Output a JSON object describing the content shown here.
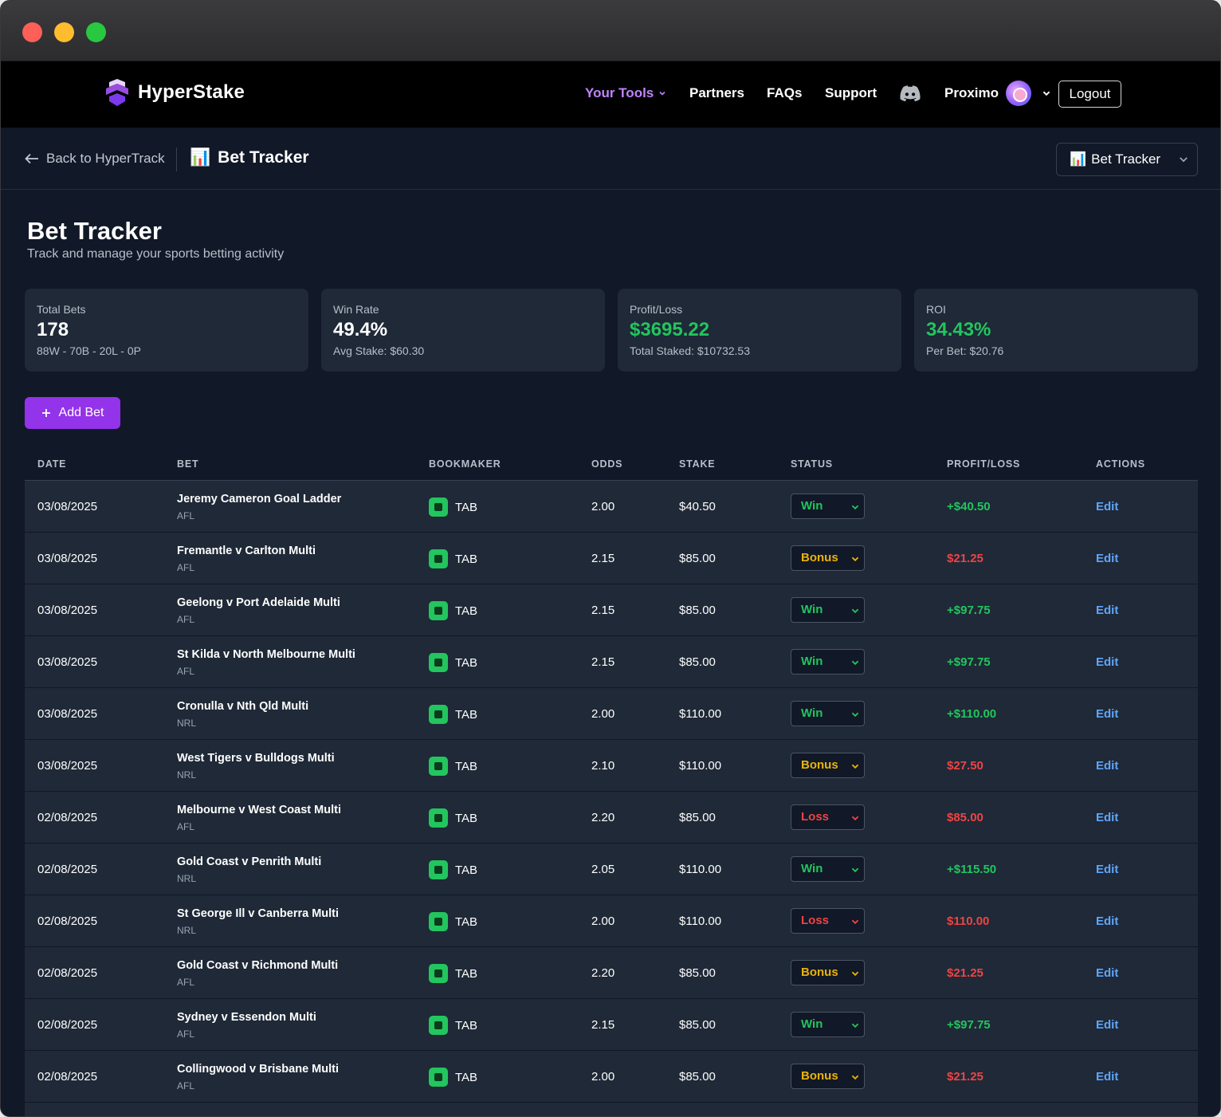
{
  "brand": {
    "name": "HyperStake"
  },
  "nav": {
    "tools": "Your Tools",
    "partners": "Partners",
    "faqs": "FAQs",
    "support": "Support",
    "user": "Proximo",
    "logout": "Logout"
  },
  "subbar": {
    "back": "Back to HyperTrack",
    "title": "Bet Tracker",
    "title_emoji": "📊",
    "tool_select": "Bet Tracker"
  },
  "page": {
    "title": "Bet Tracker",
    "subtitle": "Track and manage your sports betting activity"
  },
  "stats": [
    {
      "label": "Total Bets",
      "value": "178",
      "sub": "88W - 70B - 20L - 0P",
      "green": false
    },
    {
      "label": "Win Rate",
      "value": "49.4%",
      "sub": "Avg Stake: $60.30",
      "green": false
    },
    {
      "label": "Profit/Loss",
      "value": "$3695.22",
      "sub": "Total Staked: $10732.53",
      "green": true
    },
    {
      "label": "ROI",
      "value": "34.43%",
      "sub": "Per Bet: $20.76",
      "green": true
    }
  ],
  "add_bet": "Add Bet",
  "columns": [
    "DATE",
    "BET",
    "BOOKMAKER",
    "ODDS",
    "STAKE",
    "STATUS",
    "PROFIT/LOSS",
    "ACTIONS"
  ],
  "status_colors": {
    "Win": "#22c55e",
    "Bonus": "#eab308",
    "Loss": "#ef4444"
  },
  "pl_colors": {
    "positive": "#22c55e",
    "negative": "#ef4444"
  },
  "edit_label": "Edit",
  "rows": [
    {
      "date": "03/08/2025",
      "bet": "Jeremy Cameron Goal Ladder",
      "sport": "AFL",
      "book": "TAB",
      "odds": "2.00",
      "stake": "$40.50",
      "status": "Win",
      "pl": "+$40.50"
    },
    {
      "date": "03/08/2025",
      "bet": "Fremantle v Carlton Multi",
      "sport": "AFL",
      "book": "TAB",
      "odds": "2.15",
      "stake": "$85.00",
      "status": "Bonus",
      "pl": "$21.25"
    },
    {
      "date": "03/08/2025",
      "bet": "Geelong v Port Adelaide Multi",
      "sport": "AFL",
      "book": "TAB",
      "odds": "2.15",
      "stake": "$85.00",
      "status": "Win",
      "pl": "+$97.75"
    },
    {
      "date": "03/08/2025",
      "bet": "St Kilda v North Melbourne Multi",
      "sport": "AFL",
      "book": "TAB",
      "odds": "2.15",
      "stake": "$85.00",
      "status": "Win",
      "pl": "+$97.75"
    },
    {
      "date": "03/08/2025",
      "bet": "Cronulla v Nth Qld Multi",
      "sport": "NRL",
      "book": "TAB",
      "odds": "2.00",
      "stake": "$110.00",
      "status": "Win",
      "pl": "+$110.00"
    },
    {
      "date": "03/08/2025",
      "bet": "West Tigers v Bulldogs Multi",
      "sport": "NRL",
      "book": "TAB",
      "odds": "2.10",
      "stake": "$110.00",
      "status": "Bonus",
      "pl": "$27.50"
    },
    {
      "date": "02/08/2025",
      "bet": "Melbourne v West Coast Multi",
      "sport": "AFL",
      "book": "TAB",
      "odds": "2.20",
      "stake": "$85.00",
      "status": "Loss",
      "pl": "$85.00"
    },
    {
      "date": "02/08/2025",
      "bet": "Gold Coast v Penrith Multi",
      "sport": "NRL",
      "book": "TAB",
      "odds": "2.05",
      "stake": "$110.00",
      "status": "Win",
      "pl": "+$115.50"
    },
    {
      "date": "02/08/2025",
      "bet": "St George Ill v Canberra Multi",
      "sport": "NRL",
      "book": "TAB",
      "odds": "2.00",
      "stake": "$110.00",
      "status": "Loss",
      "pl": "$110.00"
    },
    {
      "date": "02/08/2025",
      "bet": "Gold Coast v Richmond Multi",
      "sport": "AFL",
      "book": "TAB",
      "odds": "2.20",
      "stake": "$85.00",
      "status": "Bonus",
      "pl": "$21.25"
    },
    {
      "date": "02/08/2025",
      "bet": "Sydney v Essendon Multi",
      "sport": "AFL",
      "book": "TAB",
      "odds": "2.15",
      "stake": "$85.00",
      "status": "Win",
      "pl": "+$97.75"
    },
    {
      "date": "02/08/2025",
      "bet": "Collingwood v Brisbane Multi",
      "sport": "AFL",
      "book": "TAB",
      "odds": "2.00",
      "stake": "$85.00",
      "status": "Bonus",
      "pl": "$21.25"
    }
  ]
}
